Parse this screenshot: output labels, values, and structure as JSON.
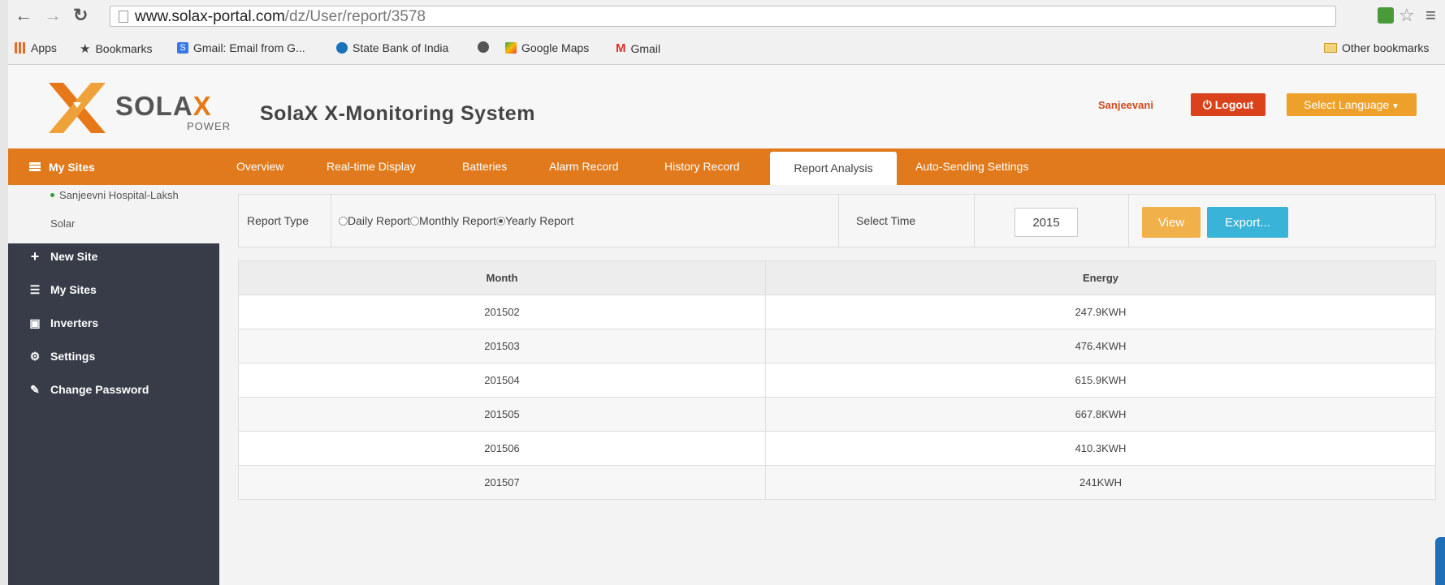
{
  "browser": {
    "url_domain": "www.solax-portal.com",
    "url_path": "/dz/User/report/3578",
    "bookmarks": [
      {
        "label": "Apps",
        "icon": "apps-grid-icon",
        "color": "#e8692a"
      },
      {
        "label": "Bookmarks",
        "icon": "star-icon",
        "color": "#444444"
      },
      {
        "label": "Gmail: Email from G...",
        "icon": "gmail-g-icon",
        "color": "#3b78e7"
      },
      {
        "label": "State Bank of India",
        "icon": "sbi-icon",
        "color": "#1a73b8"
      },
      {
        "label": "",
        "icon": "globe-icon",
        "color": "#555555"
      },
      {
        "label": "Google Maps",
        "icon": "maps-pin-icon",
        "color": "#34a853"
      },
      {
        "label": "Gmail",
        "icon": "gmail-m-icon",
        "color": "#d93025"
      }
    ],
    "other_bookmarks": "Other bookmarks"
  },
  "header": {
    "logo_main": "SOLA",
    "logo_x": "X",
    "logo_sub": "POWER",
    "title": "SolaX X-Monitoring System",
    "username": "Sanjeevani",
    "logout_label": "Logout",
    "language_label": "Select Language"
  },
  "nav": {
    "mysites_label": "My Sites",
    "tabs": [
      {
        "label": "Overview"
      },
      {
        "label": "Real-time Display"
      },
      {
        "label": "Batteries"
      },
      {
        "label": "Alarm Record"
      },
      {
        "label": "History Record"
      },
      {
        "label": "Report Analysis"
      },
      {
        "label": "Auto-Sending Settings"
      }
    ]
  },
  "sidebar": {
    "site_name_line1": "Sanjeevni Hospital-Laksh",
    "site_name_line2": "Solar",
    "items": [
      {
        "label": "New Site",
        "icon": "plus-icon"
      },
      {
        "label": "My Sites",
        "icon": "list-icon"
      },
      {
        "label": "Inverters",
        "icon": "inverter-icon"
      },
      {
        "label": "Settings",
        "icon": "gear-icon"
      },
      {
        "label": "Change Password",
        "icon": "edit-icon"
      }
    ]
  },
  "report": {
    "type_label": "Report Type",
    "options": [
      {
        "label": "Daily Report",
        "selected": false
      },
      {
        "label": "Monthly Report",
        "selected": false
      },
      {
        "label": "Yearly Report",
        "selected": true
      }
    ],
    "select_time_label": "Select Time",
    "time_value": "2015",
    "view_label": "View",
    "export_label": "Export..."
  },
  "table": {
    "headers": [
      "Month",
      "Energy"
    ],
    "rows": [
      [
        "201502",
        "247.9KWH"
      ],
      [
        "201503",
        "476.4KWH"
      ],
      [
        "201504",
        "615.9KWH"
      ],
      [
        "201505",
        "667.8KWH"
      ],
      [
        "201506",
        "410.3KWH"
      ],
      [
        "201507",
        "241KWH"
      ]
    ]
  },
  "colors": {
    "brand_orange": "#e07a1c",
    "logout_red": "#d9421b",
    "sidebar_dark": "#383c48",
    "export_blue": "#39b3d7"
  }
}
